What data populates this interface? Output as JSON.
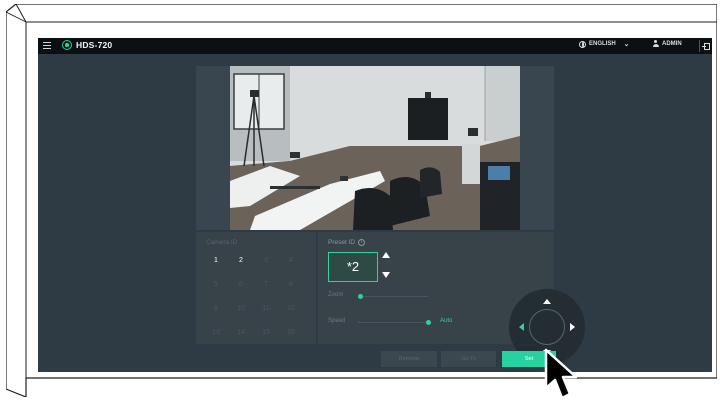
{
  "app": {
    "title": "HDS-720",
    "language": "ENGLISH",
    "user": "ADMIN"
  },
  "camera": {
    "title": "Camera ID",
    "ids": [
      "1",
      "2",
      "3",
      "4",
      "5",
      "6",
      "7",
      "8",
      "9",
      "10",
      "11",
      "12",
      "13",
      "14",
      "15",
      "16"
    ],
    "selected": "2"
  },
  "preset": {
    "title": "Preset ID",
    "value": "*2",
    "zoom_label": "Zoom",
    "speed_label": "Speed",
    "speed_mode": "Auto"
  },
  "buttons": {
    "remove": "Remove",
    "goto": "Go To",
    "set": "Set"
  },
  "colors": {
    "accent": "#26d3a0",
    "topbar": "#0c1013",
    "background": "#2f3b44"
  },
  "icons": [
    "menu-icon",
    "logo-icon",
    "globe-icon",
    "chevron-down-icon",
    "user-icon",
    "logout-icon",
    "info-icon",
    "arrow-up-icon",
    "arrow-down-icon",
    "arrow-left-icon",
    "arrow-right-icon",
    "cursor-icon"
  ]
}
